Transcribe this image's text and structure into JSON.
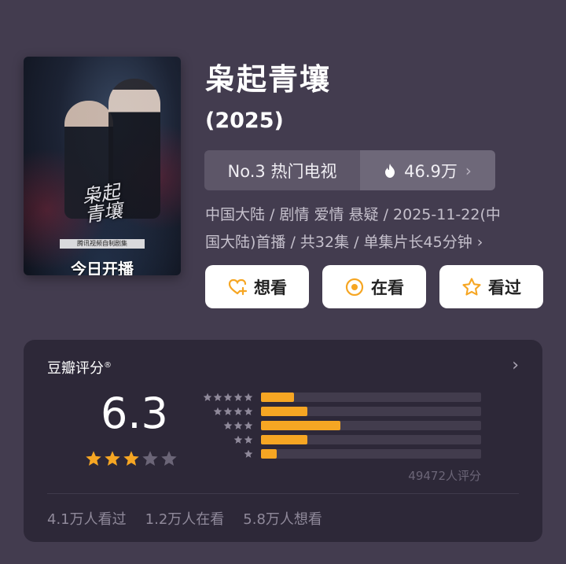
{
  "poster": {
    "calligraphy": "枭起青壤",
    "sub_tag": "腾讯视频自制剧集",
    "today_label": "今日开播"
  },
  "title": "枭起青壤",
  "year": "(2025)",
  "rank": {
    "label": "No.3 热门电视",
    "heat": "46.9万",
    "flame_icon": "flame-icon",
    "chevron": "›"
  },
  "meta": {
    "line1": "中国大陆 / 剧情 爱情 悬疑 / 2025-11-22(中",
    "line2": "国大陆)首播 / 共32集 / 单集片长45分钟 ›"
  },
  "actions": [
    {
      "label": "想看",
      "icon": "heart-plus-icon"
    },
    {
      "label": "在看",
      "icon": "eye-target-icon"
    },
    {
      "label": "看过",
      "icon": "star-outline-icon"
    }
  ],
  "rating": {
    "header": "豆瓣评分",
    "registered_mark": "®",
    "score": "6.3",
    "star_level": 3,
    "distribution": [
      {
        "stars": 5,
        "percent": 15
      },
      {
        "stars": 4,
        "percent": 21
      },
      {
        "stars": 3,
        "percent": 36
      },
      {
        "stars": 2,
        "percent": 21
      },
      {
        "stars": 1,
        "percent": 7
      }
    ],
    "count_label": "49472人评分",
    "accent_color": "#f6a623"
  },
  "stats": {
    "watched": "4.1万人看过",
    "watching": "1.2万人在看",
    "want": "5.8万人想看"
  }
}
